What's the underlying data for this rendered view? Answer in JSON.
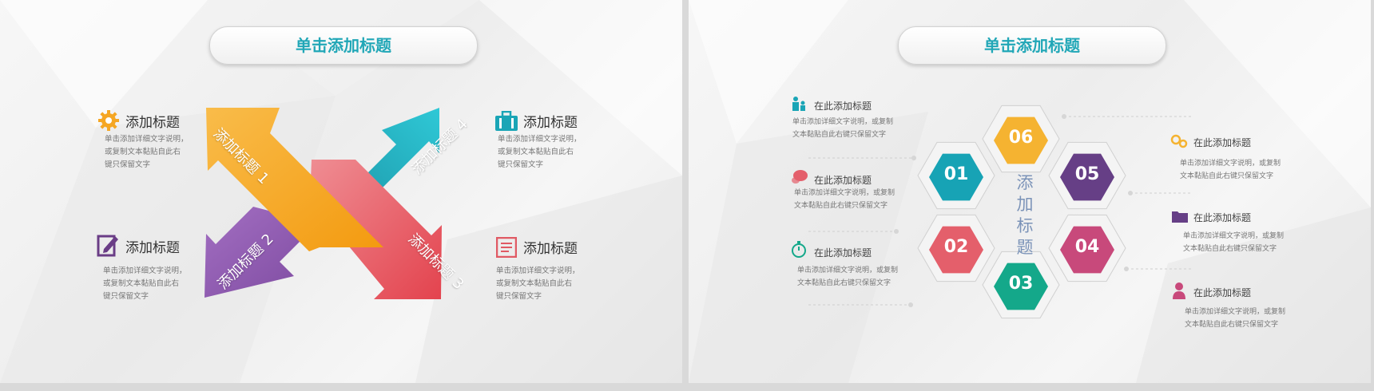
{
  "left_slide": {
    "title": "单击添加标题",
    "items": [
      {
        "title": "添加标题",
        "desc1": "单击添加详细文字说明，",
        "desc2": "或复制文本黏贴自此右",
        "desc3": "键只保留文字"
      },
      {
        "title": "添加标题",
        "desc1": "单击添加详细文字说明，",
        "desc2": "或复制文本黏贴自此右",
        "desc3": "键只保留文字"
      },
      {
        "title": "添加标题",
        "desc1": "单击添加详细文字说明，",
        "desc2": "或复制文本黏贴自此右",
        "desc3": "键只保留文字"
      },
      {
        "title": "添加标题",
        "desc1": "单击添加详细文字说明，",
        "desc2": "或复制文本黏贴自此右",
        "desc3": "键只保留文字"
      }
    ],
    "arrows": {
      "a1": "添加标题 1",
      "a2": "添加标题 2",
      "a3": "添加标题 3",
      "a4": "添加标题 4"
    },
    "colors": {
      "orange": "#f6a623",
      "purple": "#8e5bb0",
      "teal": "#2ab6c6",
      "red": "#e8505b"
    }
  },
  "right_slide": {
    "title": "单击添加标题",
    "center_text": [
      "添",
      "加",
      "标",
      "题"
    ],
    "hexes": {
      "h01": "01",
      "h02": "02",
      "h03": "03",
      "h04": "04",
      "h05": "05",
      "h06": "06"
    },
    "left_items": [
      {
        "title": "在此添加标题",
        "desc1": "单击添加详细文字说明，或复制",
        "desc2": "文本黏贴自此右键只保留文字"
      },
      {
        "title": "在此添加标题",
        "desc1": "单击添加详细文字说明，或复制",
        "desc2": "文本黏贴自此右键只保留文字"
      },
      {
        "title": "在此添加标题",
        "desc1": "单击添加详细文字说明，或复制",
        "desc2": "文本黏贴自此右键只保留文字"
      }
    ],
    "right_items": [
      {
        "title": "在此添加标题",
        "desc1": "单击添加详细文字说明，或复制",
        "desc2": "文本黏贴自此右键只保留文字"
      },
      {
        "title": "在此添加标题",
        "desc1": "单击添加详细文字说明，或复制",
        "desc2": "文本黏贴自此右键只保留文字"
      },
      {
        "title": "在此添加标题",
        "desc1": "单击添加详细文字说明，或复制",
        "desc2": "文本黏贴自此右键只保留文字"
      }
    ],
    "colors": {
      "h01": "#17a3b5",
      "h02": "#e45f6b",
      "h03": "#14a88a",
      "h04": "#c8497b",
      "h05": "#663f86",
      "h06": "#f5b331"
    }
  }
}
